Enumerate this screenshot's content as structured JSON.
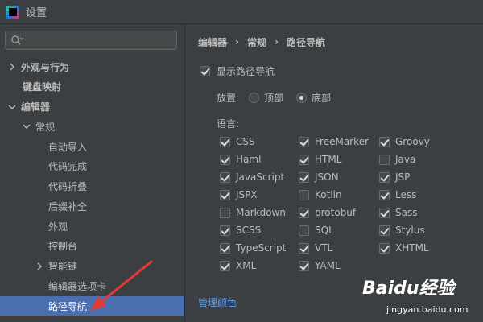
{
  "window": {
    "title": "设置"
  },
  "sidebar": {
    "search": {
      "value": "",
      "placeholder": ""
    },
    "items": [
      {
        "label": "外观与行为",
        "chevron": "right",
        "indent": 0,
        "bold": true
      },
      {
        "label": "键盘映射",
        "chevron": "none",
        "indent": 0,
        "bold": true
      },
      {
        "label": "编辑器",
        "chevron": "down",
        "indent": 0,
        "bold": true
      },
      {
        "label": "常规",
        "chevron": "down",
        "indent": 1,
        "bold": false
      },
      {
        "label": "自动导入",
        "chevron": "none",
        "indent": 2,
        "bold": false
      },
      {
        "label": "代码完成",
        "chevron": "none",
        "indent": 2,
        "bold": false
      },
      {
        "label": "代码折叠",
        "chevron": "none",
        "indent": 2,
        "bold": false
      },
      {
        "label": "后缀补全",
        "chevron": "none",
        "indent": 2,
        "bold": false
      },
      {
        "label": "外观",
        "chevron": "none",
        "indent": 2,
        "bold": false
      },
      {
        "label": "控制台",
        "chevron": "none",
        "indent": 2,
        "bold": false
      },
      {
        "label": "智能键",
        "chevron": "right",
        "indent": 2,
        "bold": false
      },
      {
        "label": "编辑器选项卡",
        "chevron": "none",
        "indent": 2,
        "bold": false
      },
      {
        "label": "路径导航",
        "chevron": "none",
        "indent": 2,
        "bold": false,
        "selected": true
      }
    ]
  },
  "main": {
    "breadcrumb": [
      "编辑器",
      "常规",
      "路径导航"
    ],
    "show_breadcrumbs": {
      "label": "显示路径导航",
      "checked": true
    },
    "placement": {
      "label": "放置:",
      "options": [
        {
          "label": "顶部",
          "selected": false
        },
        {
          "label": "底部",
          "selected": true
        }
      ]
    },
    "languages_label": "语言:",
    "languages": [
      [
        {
          "name": "CSS",
          "checked": true
        },
        {
          "name": "FreeMarker",
          "checked": true
        },
        {
          "name": "Groovy",
          "checked": true
        }
      ],
      [
        {
          "name": "Haml",
          "checked": true
        },
        {
          "name": "HTML",
          "checked": true
        },
        {
          "name": "Java",
          "checked": false
        }
      ],
      [
        {
          "name": "JavaScript",
          "checked": true
        },
        {
          "name": "JSON",
          "checked": true
        },
        {
          "name": "JSP",
          "checked": true
        }
      ],
      [
        {
          "name": "JSPX",
          "checked": true
        },
        {
          "name": "Kotlin",
          "checked": false
        },
        {
          "name": "Less",
          "checked": true
        }
      ],
      [
        {
          "name": "Markdown",
          "checked": false
        },
        {
          "name": "protobuf",
          "checked": true
        },
        {
          "name": "Sass",
          "checked": true
        }
      ],
      [
        {
          "name": "SCSS",
          "checked": true
        },
        {
          "name": "SQL",
          "checked": false
        },
        {
          "name": "Stylus",
          "checked": true
        }
      ],
      [
        {
          "name": "TypeScript",
          "checked": true
        },
        {
          "name": "VTL",
          "checked": true
        },
        {
          "name": "XHTML",
          "checked": true
        }
      ],
      [
        {
          "name": "XML",
          "checked": true
        },
        {
          "name": "YAML",
          "checked": true
        }
      ]
    ],
    "manage_colors": "管理颜色"
  },
  "watermark": {
    "logo": "Baidu经验",
    "url": "jingyan.baidu.com"
  },
  "colors": {
    "background": "#3c3f41",
    "selection": "#4b6eaf",
    "link": "#589df6",
    "annotation_arrow": "#e53935"
  }
}
